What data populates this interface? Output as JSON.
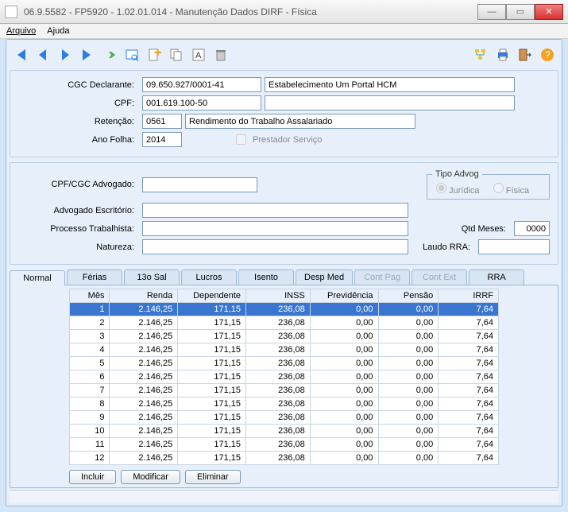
{
  "window": {
    "title": "06.9.5582 - FP5920 - 1.02.01.014 - Manutenção Dados DIRF - Física"
  },
  "menu": {
    "arquivo": "Arquivo",
    "ajuda": "Ajuda"
  },
  "toolbar_icons": {
    "first": "first-record-icon",
    "prev": "prev-record-icon",
    "next": "next-record-icon",
    "last": "last-record-icon",
    "go": "go-icon",
    "search": "search-icon",
    "new": "new-icon",
    "copy": "copy-icon",
    "font": "font-icon",
    "delete": "delete-icon",
    "tree": "tree-icon",
    "print": "print-icon",
    "exit": "exit-icon",
    "help": "help-icon"
  },
  "form1": {
    "cgc_lbl": "CGC Declarante:",
    "cgc_val": "09.650.927/0001-41",
    "estab_val": "Estabelecimento Um Portal HCM",
    "cpf_lbl": "CPF:",
    "cpf_val": "001.619.100-50",
    "retencao_lbl": "Retenção:",
    "retencao_cod": "0561",
    "retencao_desc": "Rendimento do Trabalho Assalariado",
    "ano_lbl": "Ano Folha:",
    "ano_val": "2014",
    "prestador_lbl": "Prestador Serviço"
  },
  "form2": {
    "cpfcgc_lbl": "CPF/CGC Advogado:",
    "adv_escr_lbl": "Advogado Escritório:",
    "proc_lbl": "Processo Trabalhista:",
    "natureza_lbl": "Natureza:",
    "tipo_legend": "Tipo Advog",
    "tipo_juridica": "Jurídica",
    "tipo_fisica": "Física",
    "qtd_lbl": "Qtd Meses:",
    "qtd_val": "0000",
    "laudo_lbl": "Laudo RRA:"
  },
  "tabs": {
    "normal": "Normal",
    "ferias": "Férias",
    "sal13": "13o Sal",
    "lucros": "Lucros",
    "isento": "Isento",
    "despmed": "Desp Med",
    "contpag": "Cont Pag",
    "context": "Cont Ext",
    "rra": "RRA"
  },
  "grid": {
    "cols": {
      "mes": "Mês",
      "renda": "Renda",
      "dep": "Dependente",
      "inss": "INSS",
      "prev": "Previdência",
      "pensao": "Pensão",
      "irrf": "IRRF"
    },
    "rows": [
      {
        "mes": "1",
        "renda": "2.146,25",
        "dep": "171,15",
        "inss": "236,08",
        "prev": "0,00",
        "pensao": "0,00",
        "irrf": "7,64"
      },
      {
        "mes": "2",
        "renda": "2.146,25",
        "dep": "171,15",
        "inss": "236,08",
        "prev": "0,00",
        "pensao": "0,00",
        "irrf": "7,64"
      },
      {
        "mes": "3",
        "renda": "2.146,25",
        "dep": "171,15",
        "inss": "236,08",
        "prev": "0,00",
        "pensao": "0,00",
        "irrf": "7,64"
      },
      {
        "mes": "4",
        "renda": "2.146,25",
        "dep": "171,15",
        "inss": "236,08",
        "prev": "0,00",
        "pensao": "0,00",
        "irrf": "7,64"
      },
      {
        "mes": "5",
        "renda": "2.146,25",
        "dep": "171,15",
        "inss": "236,08",
        "prev": "0,00",
        "pensao": "0,00",
        "irrf": "7,64"
      },
      {
        "mes": "6",
        "renda": "2.146,25",
        "dep": "171,15",
        "inss": "236,08",
        "prev": "0,00",
        "pensao": "0,00",
        "irrf": "7,64"
      },
      {
        "mes": "7",
        "renda": "2.146,25",
        "dep": "171,15",
        "inss": "236,08",
        "prev": "0,00",
        "pensao": "0,00",
        "irrf": "7,64"
      },
      {
        "mes": "8",
        "renda": "2.146,25",
        "dep": "171,15",
        "inss": "236,08",
        "prev": "0,00",
        "pensao": "0,00",
        "irrf": "7,64"
      },
      {
        "mes": "9",
        "renda": "2.146,25",
        "dep": "171,15",
        "inss": "236,08",
        "prev": "0,00",
        "pensao": "0,00",
        "irrf": "7,64"
      },
      {
        "mes": "10",
        "renda": "2.146,25",
        "dep": "171,15",
        "inss": "236,08",
        "prev": "0,00",
        "pensao": "0,00",
        "irrf": "7,64"
      },
      {
        "mes": "11",
        "renda": "2.146,25",
        "dep": "171,15",
        "inss": "236,08",
        "prev": "0,00",
        "pensao": "0,00",
        "irrf": "7,64"
      },
      {
        "mes": "12",
        "renda": "2.146,25",
        "dep": "171,15",
        "inss": "236,08",
        "prev": "0,00",
        "pensao": "0,00",
        "irrf": "7,64"
      }
    ]
  },
  "buttons": {
    "incluir": "Incluir",
    "modificar": "Modificar",
    "eliminar": "Eliminar"
  }
}
